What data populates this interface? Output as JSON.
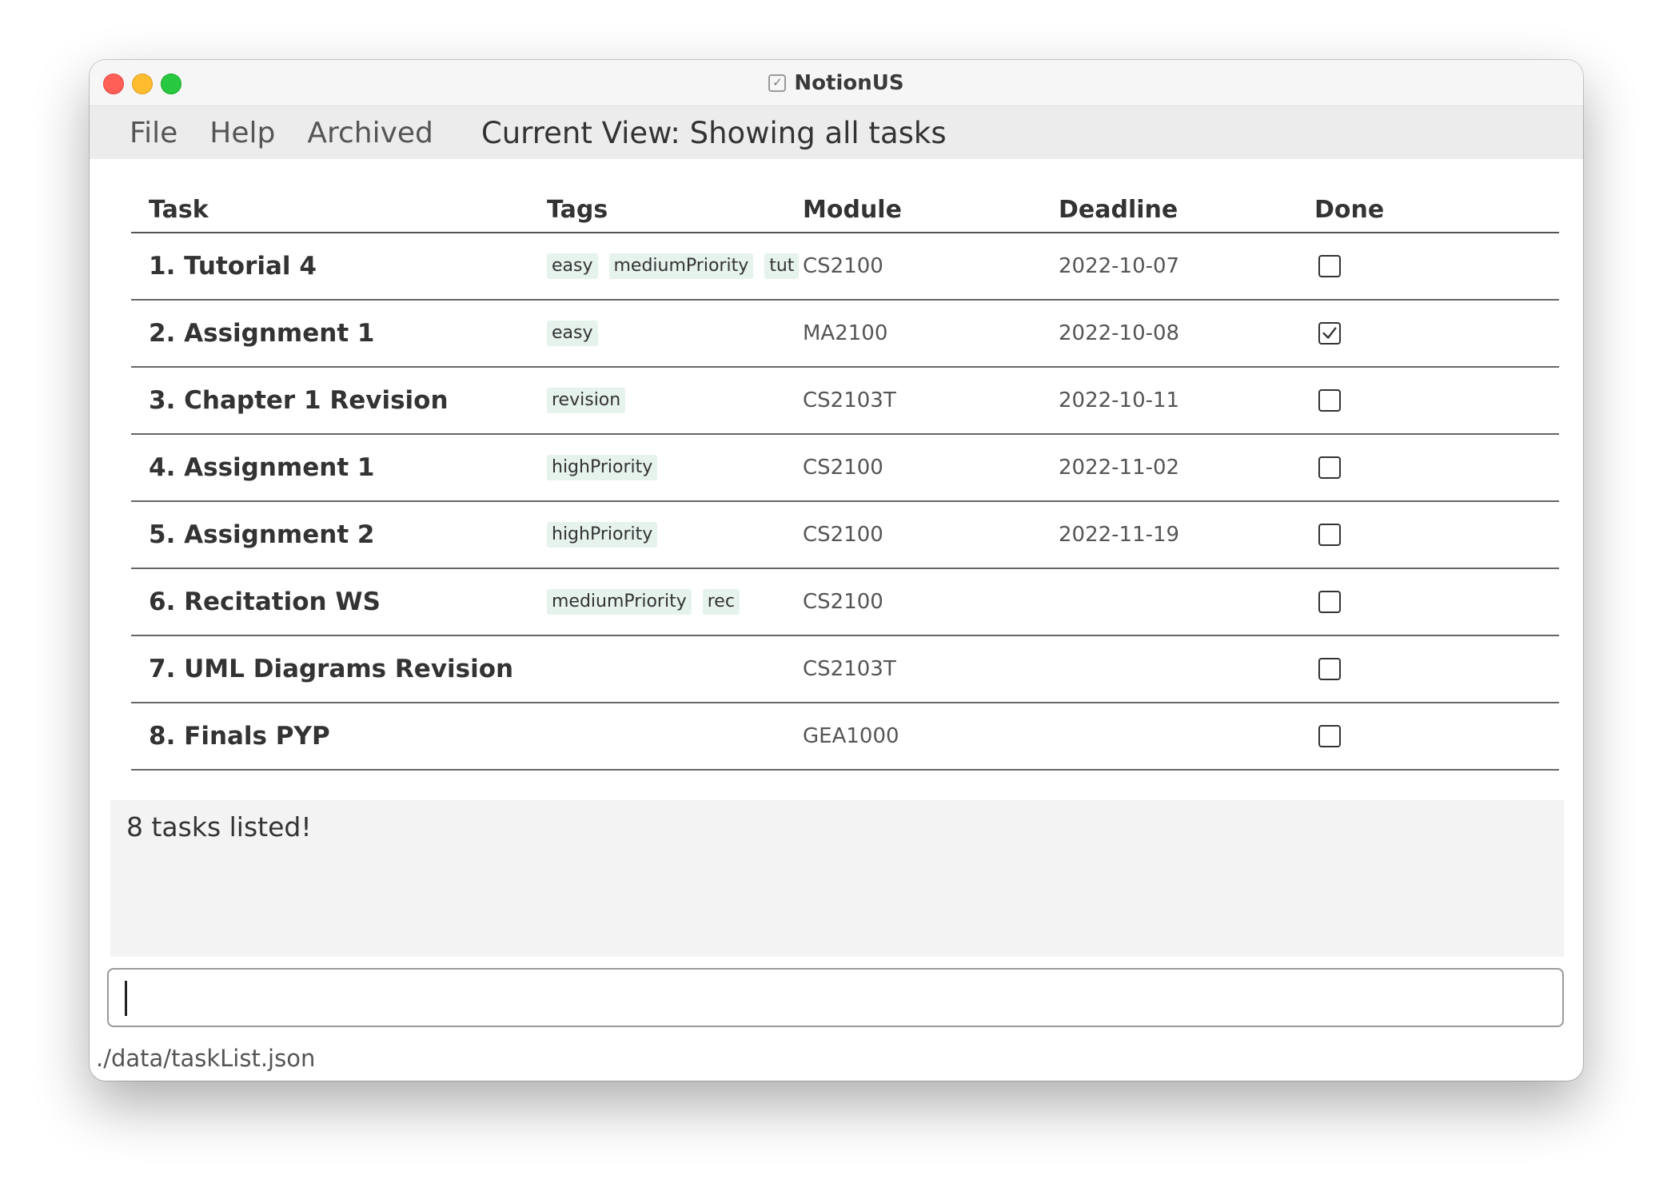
{
  "window": {
    "title": "NotionUS"
  },
  "menu": {
    "items": [
      "File",
      "Help",
      "Archived"
    ],
    "current_view": "Current View: Showing all tasks"
  },
  "table": {
    "headers": {
      "task": "Task",
      "tags": "Tags",
      "module": "Module",
      "deadline": "Deadline",
      "done": "Done"
    },
    "rows": [
      {
        "task": "1. Tutorial 4",
        "tags": [
          "easy",
          "mediumPriority",
          "tut"
        ],
        "module": "CS2100",
        "deadline": "2022-10-07",
        "done": false
      },
      {
        "task": "2. Assignment 1",
        "tags": [
          "easy"
        ],
        "module": "MA2100",
        "deadline": "2022-10-08",
        "done": true
      },
      {
        "task": "3. Chapter 1 Revision",
        "tags": [
          "revision"
        ],
        "module": "CS2103T",
        "deadline": "2022-10-11",
        "done": false
      },
      {
        "task": "4. Assignment 1",
        "tags": [
          "highPriority"
        ],
        "module": "CS2100",
        "deadline": "2022-11-02",
        "done": false
      },
      {
        "task": "5. Assignment 2",
        "tags": [
          "highPriority"
        ],
        "module": "CS2100",
        "deadline": "2022-11-19",
        "done": false
      },
      {
        "task": "6. Recitation WS",
        "tags": [
          "mediumPriority",
          "rec"
        ],
        "module": "CS2100",
        "deadline": "",
        "done": false
      },
      {
        "task": "7. UML Diagrams Revision",
        "tags": [],
        "module": "CS2103T",
        "deadline": "",
        "done": false
      },
      {
        "task": "8. Finals PYP",
        "tags": [],
        "module": "GEA1000",
        "deadline": "",
        "done": false
      }
    ]
  },
  "result": {
    "text": "8 tasks listed!"
  },
  "command": {
    "value": ""
  },
  "status": {
    "path": "./data/taskList.json"
  },
  "colors": {
    "tag_bg": "#e6f2ec",
    "close": "#ff5f57",
    "minimize": "#febc2e",
    "maximize": "#28c840"
  }
}
